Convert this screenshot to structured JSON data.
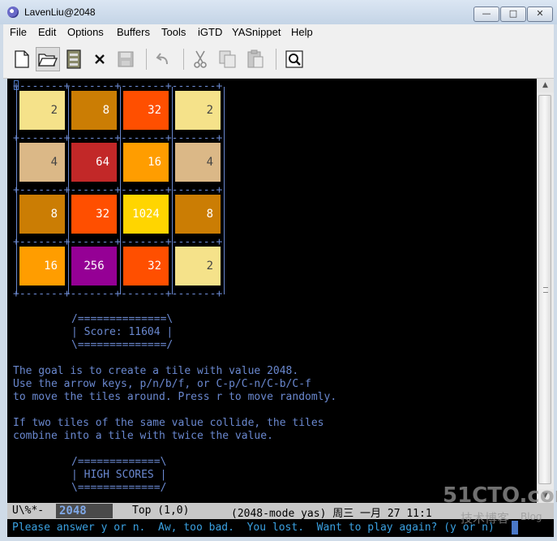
{
  "window": {
    "title": "LavenLiu@2048"
  },
  "menu": {
    "items": [
      "File",
      "Edit",
      "Options",
      "Buffers",
      "Tools",
      "iGTD",
      "YASnippet",
      "Help"
    ]
  },
  "toolbar": {
    "buttons": [
      "new-file-icon",
      "open-folder-icon",
      "dired-icon",
      "close-icon",
      "save-icon",
      "undo-icon",
      "cut-icon",
      "copy-icon",
      "paste-icon",
      "search-icon"
    ]
  },
  "board": {
    "rows": [
      [
        "2",
        "8",
        "32",
        "2"
      ],
      [
        "4",
        "64",
        "16",
        "4"
      ],
      [
        "8",
        "32",
        "1024",
        "8"
      ],
      [
        "16",
        "256",
        "32",
        "2"
      ]
    ],
    "colors": {
      "2": "#f5e28a",
      "4": "#dbb887",
      "8": "#cb7d04",
      "16": "#ff9d00",
      "32": "#ff4f00",
      "64": "#c22828",
      "256": "#950095",
      "1024": "#ffd500"
    }
  },
  "score": {
    "top_border": "/==============\\",
    "line": "| Score: 11604 |",
    "bottom_border": "\\==============/"
  },
  "instructions": {
    "line1": "The goal is to create a tile with value 2048.",
    "line2": "Use the arrow keys, p/n/b/f, or C-p/C-n/C-b/C-f",
    "line3": "to move the tiles around. Press r to move randomly.",
    "line4": "If two tiles of the same value collide, the tiles",
    "line5": "combine into a tile with twice the value."
  },
  "high_scores": {
    "top_border": "/=============\\",
    "line": "| HIGH SCORES |",
    "bottom_border": "\\=============/"
  },
  "modeline": {
    "state": "U\\%*-",
    "buffer_name": "2048",
    "position": "Top (1,0)",
    "modes": "(2048-mode yas) 周三 一月 27 11:1"
  },
  "echo": {
    "message": "Please answer y or n.  Aw, too bad.  You lost.  Want to play again? (y or n)"
  },
  "watermark": {
    "main": "51CTO.com",
    "sub": "技术博客",
    "blog": "Blog"
  }
}
